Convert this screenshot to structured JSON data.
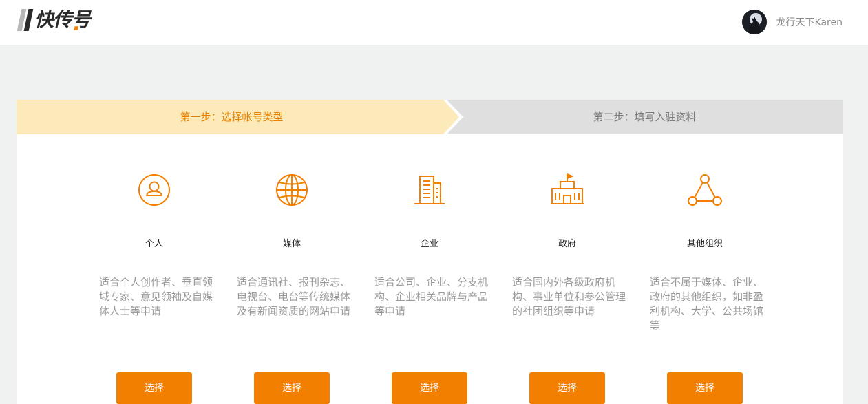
{
  "header": {
    "logo_text": "快传号",
    "username": "龙行天下Karen"
  },
  "steps": {
    "step1": "第一步：选择帐号类型",
    "step2": "第二步：填写入驻资料"
  },
  "colors": {
    "accent": "#f27f00",
    "step_active_bg": "#fdeabb",
    "step_inactive_bg": "#dfdfdf"
  },
  "cards": [
    {
      "icon": "person-icon",
      "name": "个人",
      "desc": "适合个人创作者、垂直领域专家、意见领袖及自媒体人士等申请",
      "button": "选择"
    },
    {
      "icon": "globe-icon",
      "name": "媒体",
      "desc": "适合通讯社、报刊杂志、电视台、电台等传统媒体及有新闻资质的网站申请",
      "button": "选择"
    },
    {
      "icon": "building-icon",
      "name": "企业",
      "desc": "适合公司、企业、分支机构、企业相关品牌与产品等申请",
      "button": "选择"
    },
    {
      "icon": "government-icon",
      "name": "政府",
      "desc": "适合国内外各级政府机构、事业单位和参公管理的社团组织等申请",
      "button": "选择"
    },
    {
      "icon": "network-icon",
      "name": "其他组织",
      "desc": "适合不属于媒体、企业、政府的其他组织，如非盈利机构、大学、公共场馆等",
      "button": "选择"
    }
  ]
}
